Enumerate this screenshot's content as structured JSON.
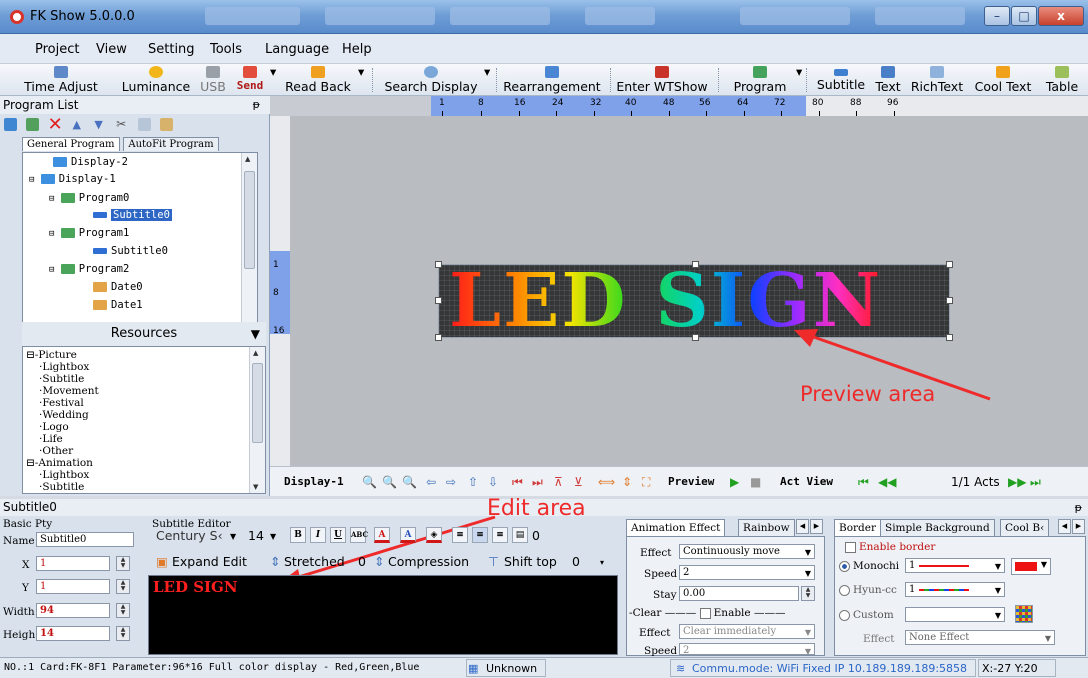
{
  "window": {
    "title": "FK Show 5.0.0.0",
    "min_label": "–",
    "max_label": "□",
    "close_label": "x"
  },
  "menu": [
    "Project",
    "View",
    "Setting",
    "Tools",
    "Language",
    "Help"
  ],
  "toolbar": {
    "time_adjust": "Time Adjust",
    "luminance": "Luminance",
    "usb": "USB",
    "send": "Send",
    "read_back": "Read Back",
    "search_display": "Search Display",
    "rearrangement": "Rearrangement",
    "enter_wtshow": "Enter WTShow",
    "program": "Program",
    "subtitle": "Subtitle",
    "text": "Text",
    "richtext": "RichText",
    "cool_text": "Cool Text",
    "table": "Table"
  },
  "program_list": {
    "header": "Program List",
    "tabs": [
      "General Program",
      "AutoFit Program"
    ],
    "tree": [
      "Display-2",
      "Display-1",
      "Program0",
      "Subtitle0",
      "Program1",
      "Subtitle0",
      "Program2",
      "Date0",
      "Date1"
    ]
  },
  "resources": {
    "header": "Resources",
    "items": [
      "Picture",
      "Lightbox",
      "Subtitle",
      "Movement",
      "Festival",
      "Wedding",
      "Logo",
      "Life",
      "Other",
      "Animation",
      "Lightbox",
      "Subtitle"
    ]
  },
  "ruler": {
    "top": [
      "1",
      "8",
      "16",
      "24",
      "32",
      "40",
      "48",
      "56",
      "64",
      "72",
      "80",
      "88",
      "96"
    ],
    "left": [
      "1",
      "8",
      "16"
    ]
  },
  "preview": {
    "led_text": "LED SIGN",
    "annotation": "Preview area",
    "display_label": "Display-1",
    "preview_label": "Preview",
    "act_view_label": "Act View",
    "acts": "1/1 Acts"
  },
  "edit": {
    "panel_title": "Subtitle0",
    "annotation": "Edit area",
    "basic_pty": "Basic Pty",
    "name_label": "Name",
    "name_value": "Subtitle0",
    "x_label": "X",
    "x_value": "1",
    "y_label": "Y",
    "y_value": "1",
    "width_label": "Width",
    "width_value": "94",
    "height_label": "Heigh",
    "height_value": "14",
    "editor_title": "Subtitle Editor",
    "font": "Century S‹",
    "font_size": "14",
    "para_value": "0",
    "expand_edit": "Expand Edit",
    "stretched": "Stretched",
    "stretched_value": "0",
    "compression": "Compression",
    "shift_top": "Shift top",
    "shift_top_value": "0",
    "content": "LED SIGN"
  },
  "animation": {
    "tabs": [
      "Animation Effect",
      "Rainbow"
    ],
    "effect_label": "Effect",
    "effect_value": "Continuously move",
    "speed_label": "Speed",
    "speed_value": "2",
    "stay_label": "Stay",
    "stay_value": "0.00",
    "clear_label": "Clear",
    "enable_label": "Enable",
    "clear_effect_label": "Effect",
    "clear_effect_value": "Clear immediately",
    "clear_speed_label": "Speed",
    "clear_speed_value": "2"
  },
  "border": {
    "tabs": [
      "Border",
      "Simple Background",
      "Cool B‹"
    ],
    "enable_label": "Enable border",
    "monochrome": "Monochi",
    "mono_value": "1",
    "hyun": "Hyun-cc",
    "hyun_value": "1",
    "custom": "Custom",
    "effect_label": "Effect",
    "effect_value": "None Effect",
    "accent": "#ee1111"
  },
  "status": {
    "card_info": "NO.:1 Card:FK-8F1 Parameter:96*16 Full color display - Red,Green,Blue",
    "unknown": "Unknown",
    "commu": "Commu.mode: WiFi Fixed IP 10.189.189.189:5858",
    "coords": "X:-27 Y:20"
  }
}
